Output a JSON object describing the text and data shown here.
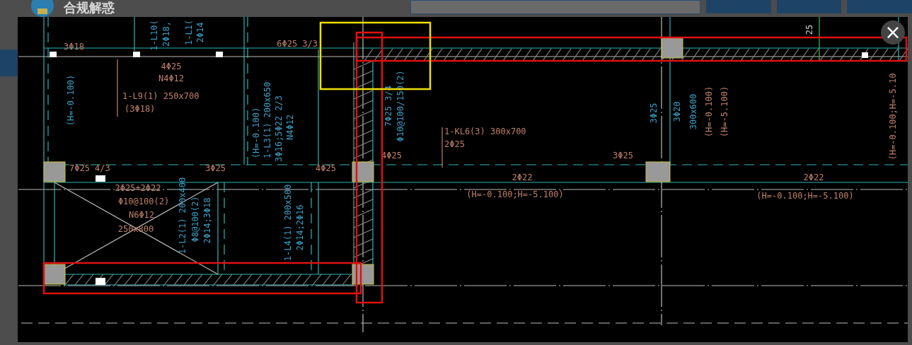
{
  "page": {
    "logo_text": "合规解惑"
  },
  "viewer": {
    "close": "×"
  },
  "labels": [
    {
      "text": "3Φ18",
      "color": "#c0806a",
      "vertical": false
    },
    {
      "text": "4Φ25",
      "color": "#c0806a",
      "vertical": false
    },
    {
      "text": "N4Φ12",
      "color": "#c0806a",
      "vertical": false
    },
    {
      "text": "1-L9(1) 250x700",
      "color": "#c0806a",
      "vertical": false
    },
    {
      "text": "(3Φ18)",
      "color": "#c0806a",
      "vertical": false
    },
    {
      "text": "6Φ25 3/3",
      "color": "#c0806a",
      "vertical": false
    },
    {
      "text": "7Φ25 4/3",
      "color": "#c0806a",
      "vertical": false
    },
    {
      "text": "3Φ25",
      "color": "#c0806a",
      "vertical": false
    },
    {
      "text": "4Φ25",
      "color": "#c0806a",
      "vertical": false
    },
    {
      "text": "4Φ25",
      "color": "#c0806a",
      "vertical": false
    },
    {
      "text": "1-KL6(3) 300x700",
      "color": "#c0806a",
      "vertical": false
    },
    {
      "text": "2Φ25",
      "color": "#c0806a",
      "vertical": false
    },
    {
      "text": "3Φ25",
      "color": "#c0806a",
      "vertical": false
    },
    {
      "text": "2Φ25+2Φ22",
      "color": "#c0806a",
      "vertical": false
    },
    {
      "text": "Φ10@100(2)",
      "color": "#c0806a",
      "vertical": false
    },
    {
      "text": "N6Φ12",
      "color": "#c0806a",
      "vertical": false
    },
    {
      "text": "250x800",
      "color": "#c0806a",
      "vertical": false
    },
    {
      "text": "2Φ22",
      "color": "#c0806a",
      "vertical": false
    },
    {
      "text": "(H=-0.100;H=-5.100)",
      "color": "#c0806a",
      "vertical": false
    },
    {
      "text": "2Φ22",
      "color": "#c0806a",
      "vertical": false
    },
    {
      "text": "(H=-0.100;H=-5.100)",
      "color": "#c0806a",
      "vertical": false
    },
    {
      "text": "1-L10(",
      "color": "#3aa0c8",
      "vertical": true
    },
    {
      "text": "2Φ18,",
      "color": "#3aa0c8",
      "vertical": true
    },
    {
      "text": "1-L1(",
      "color": "#3aa0c8",
      "vertical": true
    },
    {
      "text": "2Φ14",
      "color": "#3aa0c8",
      "vertical": true
    },
    {
      "text": "(H=-0.100)",
      "color": "#3aa0c8",
      "vertical": true
    },
    {
      "text": "(H=-0.100)",
      "color": "#3aa0c8",
      "vertical": true
    },
    {
      "text": "1-L3(1) 200x650",
      "color": "#3aa0c8",
      "vertical": true
    },
    {
      "text": "3Φ16;5Φ22 2/3",
      "color": "#3aa0c8",
      "vertical": true
    },
    {
      "text": "N4Φ12",
      "color": "#3aa0c8",
      "vertical": true
    },
    {
      "text": "7Φ25 3/4",
      "color": "#3aa0c8",
      "vertical": true
    },
    {
      "text": "Φ10@100/150(2)",
      "color": "#3aa0c8",
      "vertical": true
    },
    {
      "text": "3Φ25",
      "color": "#3aa0c8",
      "vertical": true
    },
    {
      "text": "3Φ20",
      "color": "#3aa0c8",
      "vertical": true
    },
    {
      "text": "300x600",
      "color": "#3aa0c8",
      "vertical": true
    },
    {
      "text": "(H=-0.100)",
      "color": "#c0806a",
      "vertical": true
    },
    {
      "text": "(H=-5.100)",
      "color": "#c0806a",
      "vertical": true
    },
    {
      "text": "(H=-0.100;H=-5.10",
      "color": "#c0806a",
      "vertical": true
    },
    {
      "text": "1-L2(1) 200x400",
      "color": "#3aa0c8",
      "vertical": true
    },
    {
      "text": "Φ8@100(2)",
      "color": "#3aa0c8",
      "vertical": true
    },
    {
      "text": "2Φ14;3Φ18",
      "color": "#3aa0c8",
      "vertical": true
    },
    {
      "text": "1-L4(1) 200x500",
      "color": "#3aa0c8",
      "vertical": true
    },
    {
      "text": "2Φ14;2Φ16",
      "color": "#3aa0c8",
      "vertical": true
    },
    {
      "text": "25",
      "color": "#d0d0d0",
      "vertical": true
    }
  ]
}
